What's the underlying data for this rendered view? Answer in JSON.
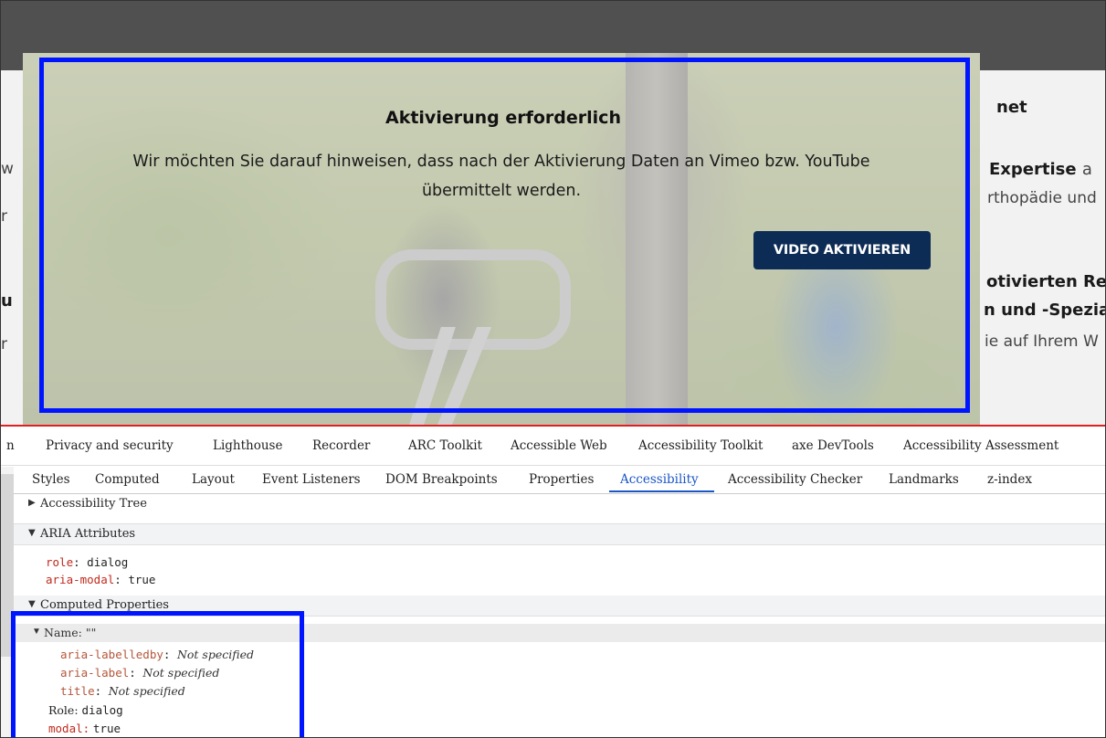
{
  "page": {
    "right_texts": {
      "heading_fragment": "net",
      "expertise": "Expertise",
      "expertise_tail": "a",
      "orthopaedie": "rthopädie und",
      "motivierten": "otivierten Re",
      "spezial": "n und -Spezia",
      "ihrem": "ie auf Ihrem W"
    },
    "left_texts": {
      "a": "w",
      "b": "r",
      "c": "u",
      "d": "r"
    }
  },
  "dialog": {
    "title": "Aktivierung erforderlich",
    "text": "Wir möchten Sie darauf hinweisen, dass nach der Aktivierung Daten an Vimeo bzw. YouTube übermittelt werden.",
    "button": "VIDEO AKTIVIEREN"
  },
  "devtools": {
    "tabs_row1": [
      "n",
      "Privacy and security",
      "Lighthouse",
      "Recorder",
      "ARC Toolkit",
      "Accessible Web",
      "Accessibility Toolkit",
      "axe DevTools",
      "Accessibility Assessment"
    ],
    "tabs_row2": [
      "Styles",
      "Computed",
      "Layout",
      "Event Listeners",
      "DOM Breakpoints",
      "Properties",
      "Accessibility",
      "Accessibility Checker",
      "Landmarks",
      "z-index"
    ],
    "active_tab": "Accessibility",
    "sections": {
      "tree": "Accessibility Tree",
      "aria": "ARIA Attributes",
      "computed": "Computed Properties"
    },
    "aria_attributes": [
      {
        "name": "role",
        "value": "dialog"
      },
      {
        "name": "aria-modal",
        "value": "true"
      }
    ],
    "computed": {
      "name_label": "Name: \"\"",
      "sources": [
        {
          "name": "aria-labelledby",
          "value": "Not specified"
        },
        {
          "name": "aria-label",
          "value": "Not specified"
        },
        {
          "name": "title",
          "value": "Not specified"
        }
      ],
      "role_label": "Role:",
      "role_value": "dialog",
      "modal_label": "modal:",
      "modal_value": "true"
    }
  }
}
